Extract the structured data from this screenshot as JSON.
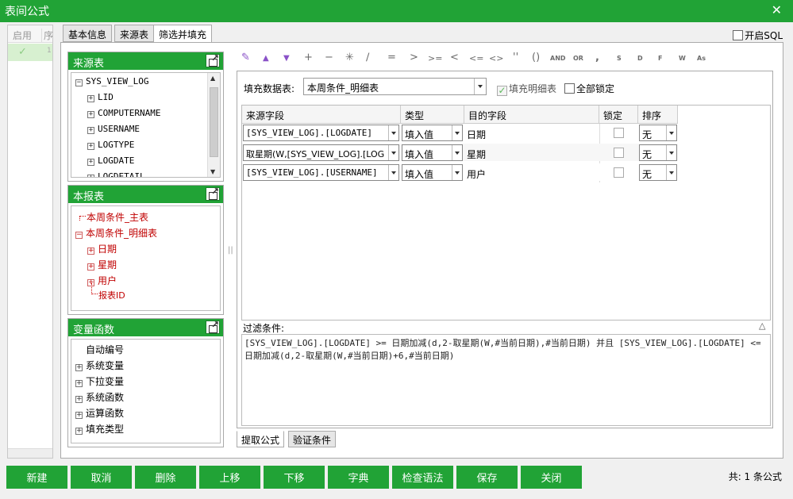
{
  "window": {
    "title": "表间公式",
    "close_icon": "✕"
  },
  "left_list": {
    "col_enabled": "启用",
    "col_seq": "序",
    "row_check": "✓",
    "row_seq": "1"
  },
  "tabs": [
    "基本信息",
    "来源表",
    "筛选并填充"
  ],
  "open_sql": {
    "label": "开启SQL",
    "checked": false
  },
  "source_panel": {
    "title": "来源表",
    "root": "SYS_VIEW_LOG",
    "fields": [
      "LID",
      "COMPUTERNAME",
      "USERNAME",
      "LOGTYPE",
      "LOGDATE",
      "LOGDETAIL"
    ]
  },
  "report_panel": {
    "title": "本报表",
    "main_table": "本周条件_主表",
    "detail_table": "本周条件_明细表",
    "detail_fields": [
      "日期",
      "星期",
      "用户"
    ],
    "report_id": "报表ID"
  },
  "variable_panel": {
    "title": "变量函数",
    "items": [
      "自动编号",
      "系统变量",
      "下拉变量",
      "系统函数",
      "运算函数",
      "填充类型"
    ]
  },
  "toolbar": [
    {
      "name": "format-brush-icon",
      "glyph": "✎"
    },
    {
      "name": "move-up-icon",
      "glyph": "▲"
    },
    {
      "name": "move-down-icon",
      "glyph": "▼"
    },
    {
      "name": "plus-op",
      "glyph": "+"
    },
    {
      "name": "minus-op",
      "glyph": "−"
    },
    {
      "name": "multiply-op",
      "glyph": "✳"
    },
    {
      "name": "divide-op",
      "glyph": "∕"
    },
    {
      "name": "equals-op",
      "glyph": "="
    },
    {
      "name": "greater-op",
      "glyph": ">"
    },
    {
      "name": "greater-equal-op",
      "glyph": ">="
    },
    {
      "name": "less-op",
      "glyph": "<"
    },
    {
      "name": "less-equal-op",
      "glyph": "<="
    },
    {
      "name": "not-equal-op",
      "glyph": "<>"
    },
    {
      "name": "quote-op",
      "glyph": "''"
    },
    {
      "name": "parentheses-op",
      "glyph": "()"
    },
    {
      "name": "and-op",
      "glyph": "AND"
    },
    {
      "name": "or-op",
      "glyph": "OR"
    },
    {
      "name": "comma-op",
      "glyph": ","
    },
    {
      "name": "s-op",
      "glyph": "S"
    },
    {
      "name": "d-op",
      "glyph": "D"
    },
    {
      "name": "f-op",
      "glyph": "F"
    },
    {
      "name": "w-op",
      "glyph": "W"
    },
    {
      "name": "as-op",
      "glyph": "As"
    }
  ],
  "fill": {
    "label": "填充数据表:",
    "selected": "本周条件_明细表",
    "fill_detail": {
      "label": "填充明细表",
      "checked": true
    },
    "lock_all": {
      "label": "全部锁定",
      "checked": false
    }
  },
  "grid": {
    "headers": [
      "来源字段",
      "类型",
      "目的字段",
      "锁定",
      "排序"
    ],
    "rows": [
      {
        "source": "[SYS_VIEW_LOG].[LOGDATE]",
        "type": "填入值",
        "target": "日期",
        "locked": false,
        "sort": "无"
      },
      {
        "source": "取星期(W,[SYS_VIEW_LOG].[LOGDATE])",
        "type": "填入值",
        "target": "星期",
        "locked": false,
        "sort": "无"
      },
      {
        "source": "[SYS_VIEW_LOG].[USERNAME]",
        "type": "填入值",
        "target": "用户",
        "locked": false,
        "sort": "无"
      }
    ]
  },
  "filter": {
    "label": "过滤条件:",
    "toggle": "△",
    "text": " [SYS_VIEW_LOG].[LOGDATE]  >= 日期加减(d,2-取星期(W,#当前日期),#当前日期) 并且  [SYS_VIEW_LOG].[LOGDATE]  <= 日期加减(d,2-取星期(W,#当前日期)+6,#当前日期)"
  },
  "bottom_tabs": [
    "提取公式",
    "验证条件"
  ],
  "buttons": [
    "新建",
    "取消",
    "删除",
    "上移",
    "下移",
    "字典",
    "检查语法",
    "保存",
    "关闭"
  ],
  "total": "共: 1 条公式",
  "colors": {
    "accent_green": "#21a336",
    "tree_red": "#c00000"
  }
}
